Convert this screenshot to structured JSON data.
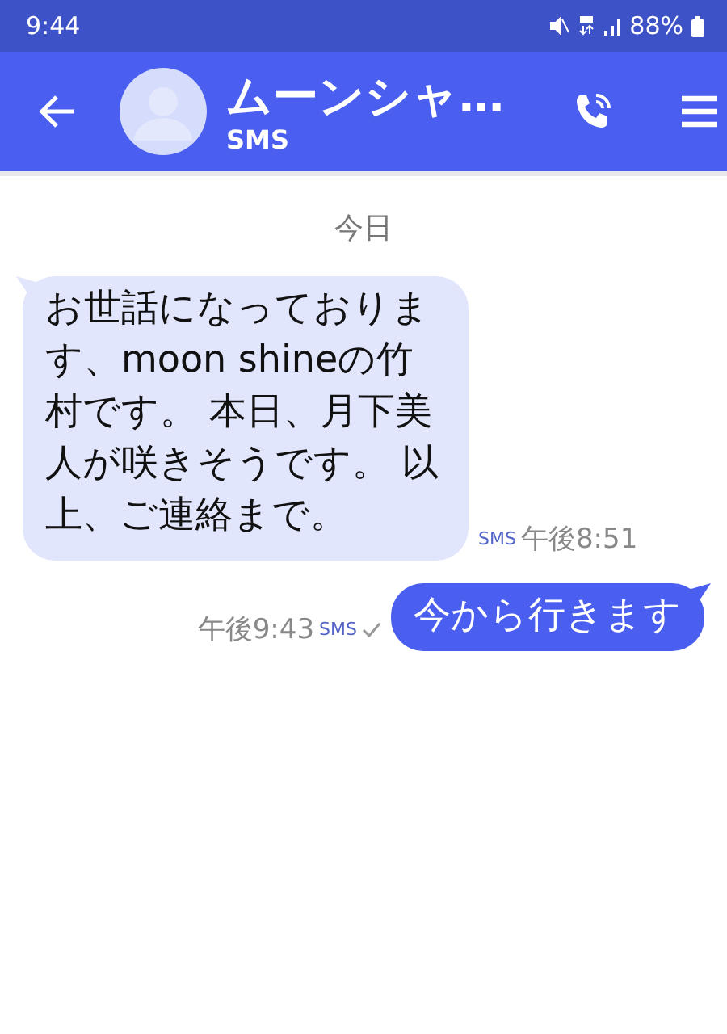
{
  "status_bar": {
    "time": "9:44",
    "battery": "88%"
  },
  "header": {
    "title": "ムーンシャ…",
    "subtitle": "SMS"
  },
  "date_divider": "今日",
  "messages": [
    {
      "kind": "incoming",
      "text": "お世話になっております、moon shineの竹村です。 本日、月下美人が咲きそうです。 以上、ご連絡まで。",
      "channel": "SMS",
      "time": "午後8:51"
    },
    {
      "kind": "outgoing",
      "text": "今から行きます",
      "channel": "SMS",
      "time": "午後9:43",
      "delivered": true
    }
  ]
}
